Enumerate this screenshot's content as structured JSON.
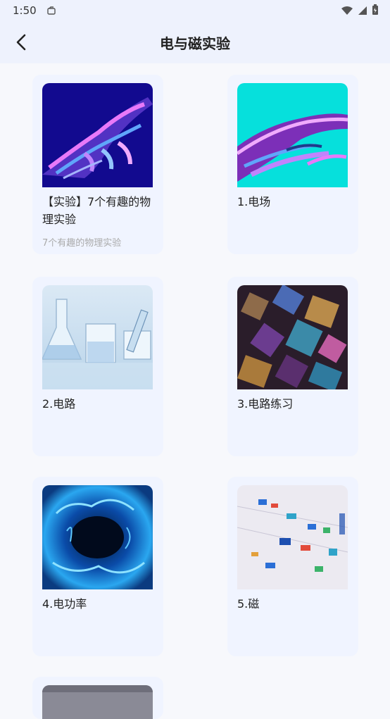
{
  "status": {
    "time": "1:50"
  },
  "header": {
    "title": "电与磁实验"
  },
  "cards": [
    {
      "title": "【实验】7个有趣的物理实验",
      "subtitle": "7个有趣的物理实验",
      "image_icon": "holographic-hand-image"
    },
    {
      "title": "1.电场",
      "subtitle": "",
      "image_icon": "holographic-hand-cyan-image"
    },
    {
      "title": "2.电路",
      "subtitle": "",
      "image_icon": "lab-glassware-image"
    },
    {
      "title": "3.电路练习",
      "subtitle": "",
      "image_icon": "bismuth-crystal-image"
    },
    {
      "title": "4.电功率",
      "subtitle": "",
      "image_icon": "blue-plasma-image"
    },
    {
      "title": "5.磁",
      "subtitle": "",
      "image_icon": "circuit-blocks-image"
    }
  ],
  "colors": {
    "background": "#f7f8fc",
    "header": "#eef2fd",
    "card": "#f0f4ff"
  }
}
